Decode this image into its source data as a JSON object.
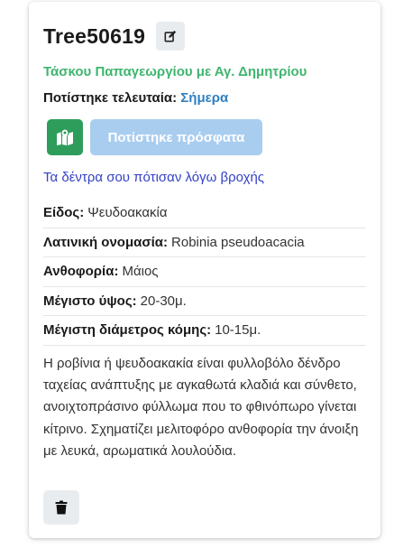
{
  "tree": {
    "title": "Tree50619",
    "address": "Τάσκου Παπαγεωργίου με Αγ. Δημητρίου",
    "last_watered_label": "Ποτίστηκε τελευταία:",
    "last_watered_value": "Σήμερα",
    "watered_button_label": "Ποτίστηκε πρόσφατα",
    "rain_message": "Τα δέντρα σου πότισαν λόγω βροχής",
    "properties": [
      {
        "key": "Είδος:",
        "value": "Ψευδοακακία"
      },
      {
        "key": "Λατινική ονομασία:",
        "value": "Robinia pseudoacacia"
      },
      {
        "key": "Ανθοφορία:",
        "value": "Μάιος"
      },
      {
        "key": "Μέγιστο ύψος:",
        "value": "20-30μ."
      },
      {
        "key": "Μέγιστη διάμετρος κόμης:",
        "value": "10-15μ."
      }
    ],
    "description": "Η ροβίνια ή ψευδοακακία είναι φυλλοβόλο δένδρο ταχείας ανάπτυξης με αγκαθωτά κλαδιά και σύνθετο, ανοιχτοπράσινο φύλλωμα που το φθινόπωρο γίνεται κίτρινο. Σχηματίζει μελιτοφόρο ανθοφορία την άνοιξη με λευκά, αρωματικά λουλούδια."
  },
  "icons": {
    "edit": "edit-icon",
    "map": "map-icon",
    "delete": "trash-icon"
  },
  "colors": {
    "address": "#3fb56f",
    "last_watered_value": "#2f7fc1",
    "map_button": "#2e9d5b",
    "watered_button": "#a9cdef",
    "rain_message": "#3341c8"
  }
}
